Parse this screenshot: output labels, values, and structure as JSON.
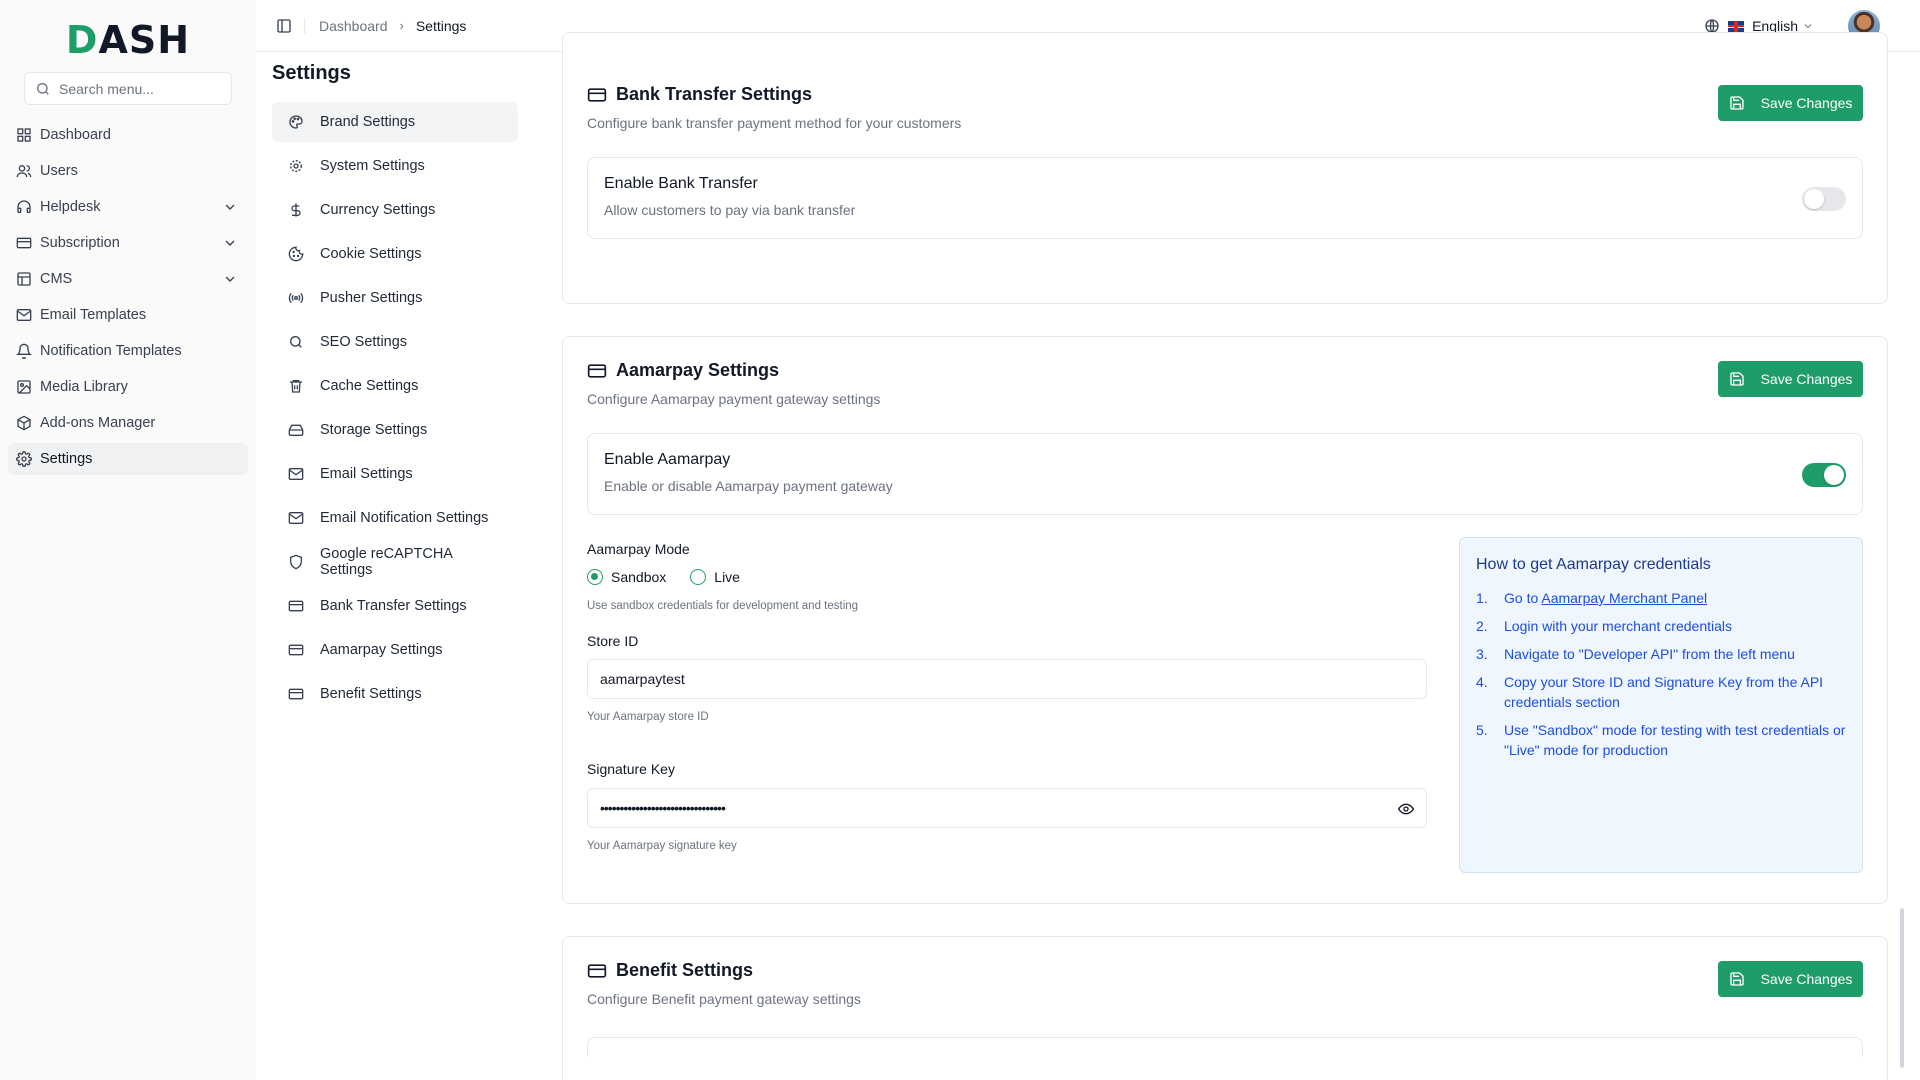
{
  "sidebar": {
    "logo": "DASH",
    "search_placeholder": "Search menu...",
    "items": [
      {
        "label": "Dashboard",
        "icon": "dashboard-icon"
      },
      {
        "label": "Users",
        "icon": "users-icon"
      },
      {
        "label": "Helpdesk",
        "icon": "headset-icon",
        "expandable": true
      },
      {
        "label": "Subscription",
        "icon": "card-icon",
        "expandable": true
      },
      {
        "label": "CMS",
        "icon": "layout-icon",
        "expandable": true
      },
      {
        "label": "Email Templates",
        "icon": "mail-icon"
      },
      {
        "label": "Notification Templates",
        "icon": "bell-icon"
      },
      {
        "label": "Media Library",
        "icon": "image-icon"
      },
      {
        "label": "Add-ons Manager",
        "icon": "package-icon"
      },
      {
        "label": "Settings",
        "icon": "gear-icon",
        "active": true
      }
    ]
  },
  "header": {
    "breadcrumb": [
      "Dashboard",
      "Settings"
    ],
    "language": "English"
  },
  "page": {
    "title": "Settings"
  },
  "settings_nav": [
    {
      "label": "Brand Settings",
      "icon": "palette-icon",
      "active": true
    },
    {
      "label": "System Settings",
      "icon": "gear-icon"
    },
    {
      "label": "Currency Settings",
      "icon": "dollar-icon"
    },
    {
      "label": "Cookie Settings",
      "icon": "cookie-icon"
    },
    {
      "label": "Pusher Settings",
      "icon": "broadcast-icon"
    },
    {
      "label": "SEO Settings",
      "icon": "search-icon"
    },
    {
      "label": "Cache Settings",
      "icon": "trash-icon"
    },
    {
      "label": "Storage Settings",
      "icon": "hard-drive-icon"
    },
    {
      "label": "Email Settings",
      "icon": "mail-icon"
    },
    {
      "label": "Email Notification Settings",
      "icon": "mail-icon"
    },
    {
      "label": "Google reCAPTCHA Settings",
      "icon": "shield-icon"
    },
    {
      "label": "Bank Transfer Settings",
      "icon": "card-icon"
    },
    {
      "label": "Aamarpay Settings",
      "icon": "card-icon"
    },
    {
      "label": "Benefit Settings",
      "icon": "card-icon"
    }
  ],
  "bank_transfer": {
    "title": "Bank Transfer Settings",
    "description": "Configure bank transfer payment method for your customers",
    "save_label": "Save Changes",
    "toggle_title": "Enable Bank Transfer",
    "toggle_desc": "Allow customers to pay via bank transfer",
    "enabled": false
  },
  "aamarpay": {
    "title": "Aamarpay Settings",
    "description": "Configure Aamarpay payment gateway settings",
    "save_label": "Save Changes",
    "toggle_title": "Enable Aamarpay",
    "toggle_desc": "Enable or disable Aamarpay payment gateway",
    "enabled": true,
    "mode_label": "Aamarpay Mode",
    "mode_options": [
      "Sandbox",
      "Live"
    ],
    "mode_selected": "Sandbox",
    "mode_help": "Use sandbox credentials for development and testing",
    "store_id_label": "Store ID",
    "store_id_value": "aamarpaytest",
    "store_id_help": "Your Aamarpay store ID",
    "signature_label": "Signature Key",
    "signature_value": "••••••••••••••••••••••••••••••••",
    "signature_help": "Your Aamarpay signature key",
    "info": {
      "title": "How to get Aamarpay credentials",
      "steps": [
        {
          "num": "1.",
          "prefix": "Go to ",
          "link": "Aamarpay Merchant Panel"
        },
        {
          "num": "2.",
          "text": "Login with your merchant credentials"
        },
        {
          "num": "3.",
          "text": "Navigate to \"Developer API\" from the left menu"
        },
        {
          "num": "4.",
          "text": "Copy your Store ID and Signature Key from the API credentials section"
        },
        {
          "num": "5.",
          "text": "Use \"Sandbox\" mode for testing with test credentials or \"Live\" mode for production"
        }
      ]
    }
  },
  "benefit": {
    "title": "Benefit Settings",
    "description": "Configure Benefit payment gateway settings",
    "save_label": "Save Changes"
  },
  "colors": {
    "brand": "#1f9d68",
    "info_bg": "#eff6fd",
    "info_text": "#1d4ed8"
  }
}
